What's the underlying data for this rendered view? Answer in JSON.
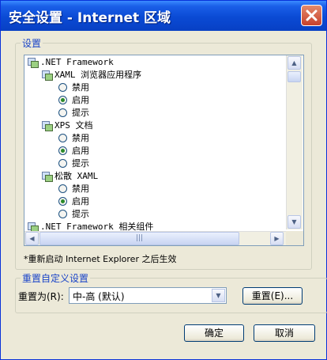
{
  "window": {
    "title": "安全设置 - Internet 区域",
    "close_icon": "close-icon"
  },
  "settings": {
    "group_label": "设置",
    "tree": [
      {
        "label": ".NET Framework",
        "icon": "settings-folder-icon",
        "kind": "header"
      },
      {
        "label": "XAML 浏览器应用程序",
        "icon": "settings-folder-icon",
        "kind": "subheader"
      },
      {
        "label": "禁用",
        "kind": "radio",
        "selected": false
      },
      {
        "label": "启用",
        "kind": "radio",
        "selected": true
      },
      {
        "label": "提示",
        "kind": "radio",
        "selected": false
      },
      {
        "label": "XPS 文档",
        "icon": "settings-folder-icon",
        "kind": "subheader"
      },
      {
        "label": "禁用",
        "kind": "radio",
        "selected": false
      },
      {
        "label": "启用",
        "kind": "radio",
        "selected": true
      },
      {
        "label": "提示",
        "kind": "radio",
        "selected": false
      },
      {
        "label": "松散 XAML",
        "icon": "settings-folder-icon",
        "kind": "subheader"
      },
      {
        "label": "禁用",
        "kind": "radio",
        "selected": false
      },
      {
        "label": "启用",
        "kind": "radio",
        "selected": true
      },
      {
        "label": "提示",
        "kind": "radio",
        "selected": false
      },
      {
        "label": ".NET Framework 相关组件",
        "icon": "settings-folder-icon",
        "kind": "header"
      }
    ],
    "note": "*重新启动 Internet Explorer 之后生效"
  },
  "reset": {
    "group_label": "重置自定义设置",
    "reset_to_label": "重置为(R):",
    "level_value": "中-高 (默认)",
    "reset_button": "重置(E)..."
  },
  "footer": {
    "ok_button": "确定",
    "cancel_button": "取消"
  }
}
